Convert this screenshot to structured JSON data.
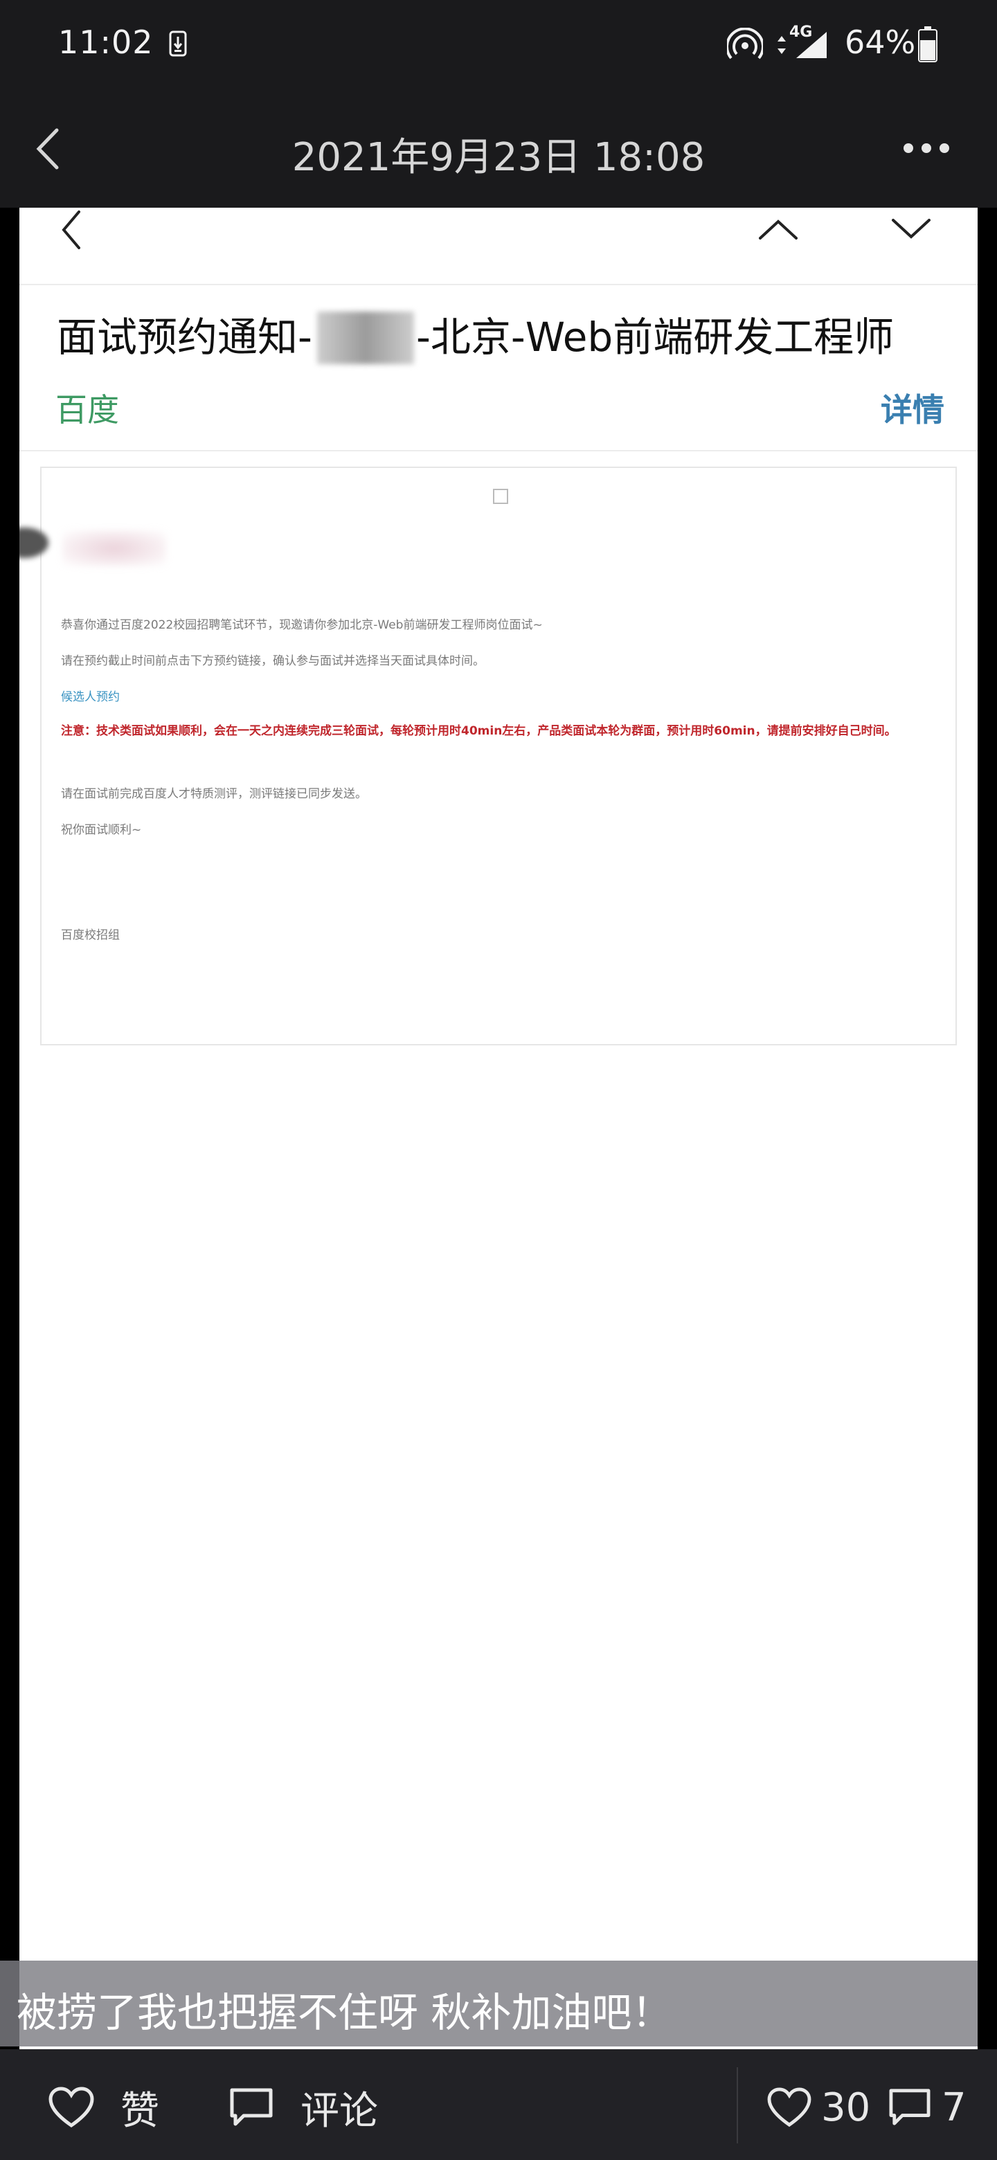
{
  "status_bar": {
    "time": "11:02",
    "network": "4G",
    "battery": "64%"
  },
  "nav": {
    "title": "2021年9月23日 18:08"
  },
  "mail": {
    "subject_prefix": "面试预约通知-",
    "subject_suffix": "-北京-Web前端研发工程师",
    "sender": "百度",
    "details_label": "详情",
    "body": {
      "line1": "恭喜你通过百度2022校园招聘笔试环节，现邀请你参加北京-Web前端研发工程师岗位面试~",
      "line2": "请在预约截止时间前点击下方预约链接，确认参与面试并选择当天面试具体时间。",
      "link": "候选人预约",
      "note": "注意：技术类面试如果顺利，会在一天之内连续完成三轮面试，每轮预计用时40min左右，产品类面试本轮为群面，预计用时60min，请提前安排好自己时间。",
      "line3": "请在面试前完成百度人才特质测评，测评链接已同步发送。",
      "line4": "祝你面试顺利~",
      "signature": "百度校招组"
    }
  },
  "post": {
    "caption": "被捞了我也把握不住呀  秋补加油吧！",
    "like_label": "赞",
    "comment_label": "评论",
    "like_count": "30",
    "comment_count": "7"
  },
  "colors": {
    "sender_green": "#3e9a63",
    "details_blue": "#3a7fb0",
    "link_blue": "#3a93c2",
    "note_red": "#c0262c",
    "bar_bg": "#1a1a1c"
  }
}
